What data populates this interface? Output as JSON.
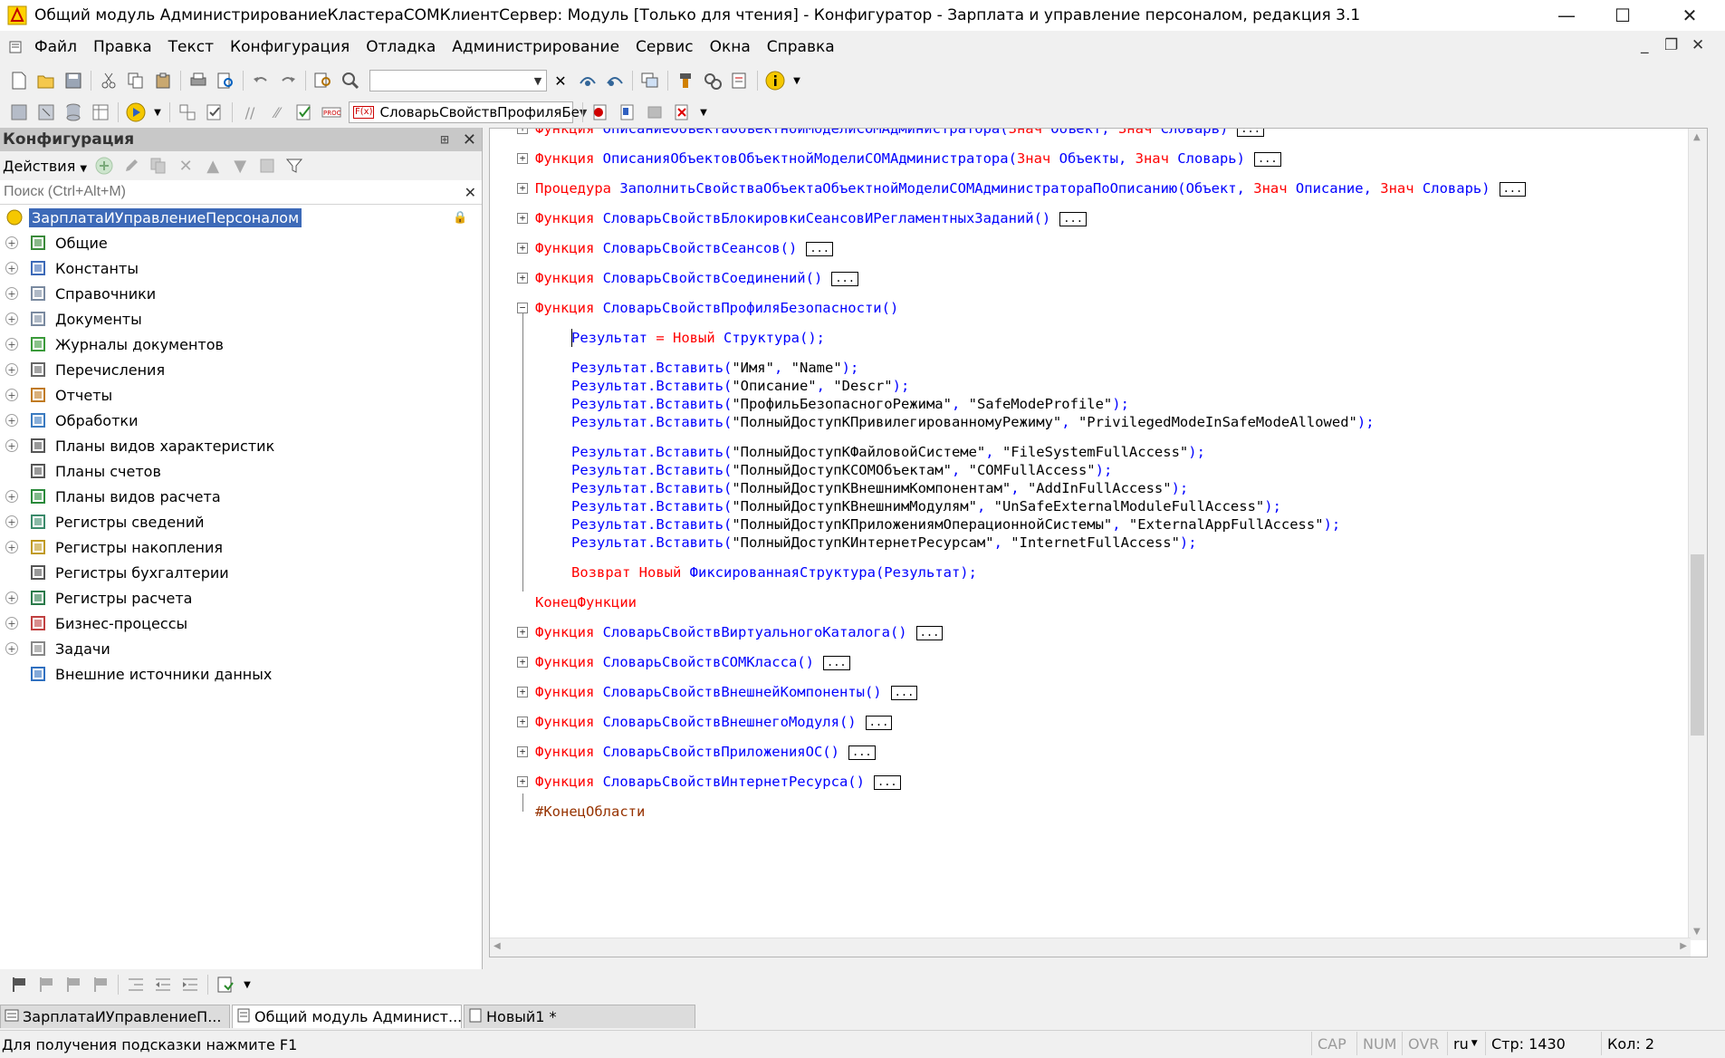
{
  "window": {
    "title": "Общий модуль АдминистрированиеКластераCOMКлиентСервер: Модуль [Только для чтения] - Конфигуратор - Зарплата и управление персоналом, редакция 3.1",
    "min": "—",
    "max": "☐",
    "close": "✕"
  },
  "menu": {
    "items": [
      "Файл",
      "Правка",
      "Текст",
      "Конфигурация",
      "Отладка",
      "Администрирование",
      "Сервис",
      "Окна",
      "Справка"
    ]
  },
  "toolbar": {
    "search_value": "",
    "proc_combo_prefix": "F(x)",
    "proc_combo_value": "СловарьСвойствПрофиляБе"
  },
  "config_panel": {
    "title": "Конфигурация",
    "actions_label": "Действия",
    "search_placeholder": "Поиск (Ctrl+Alt+M)",
    "root": "ЗарплатаИУправлениеПерсоналом",
    "items": [
      {
        "label": "Общие",
        "exp": true
      },
      {
        "label": "Константы",
        "exp": true
      },
      {
        "label": "Справочники",
        "exp": true
      },
      {
        "label": "Документы",
        "exp": true
      },
      {
        "label": "Журналы документов",
        "exp": true
      },
      {
        "label": "Перечисления",
        "exp": true
      },
      {
        "label": "Отчеты",
        "exp": true
      },
      {
        "label": "Обработки",
        "exp": true
      },
      {
        "label": "Планы видов характеристик",
        "exp": true
      },
      {
        "label": "Планы счетов",
        "exp": false
      },
      {
        "label": "Планы видов расчета",
        "exp": true
      },
      {
        "label": "Регистры сведений",
        "exp": true
      },
      {
        "label": "Регистры накопления",
        "exp": true
      },
      {
        "label": "Регистры бухгалтерии",
        "exp": false
      },
      {
        "label": "Регистры расчета",
        "exp": true
      },
      {
        "label": "Бизнес-процессы",
        "exp": true
      },
      {
        "label": "Задачи",
        "exp": true
      },
      {
        "label": "Внешние источники данных",
        "exp": false
      }
    ]
  },
  "code": {
    "collapsed_marker": "...",
    "lines": [
      {
        "kw": "Функция",
        "rest": "ОписаниеОбъектаОбъектнойМоделиCOMАдминистратора(",
        "params": [
          [
            "Знач",
            "Объект"
          ],
          [
            "Знач",
            "Словарь"
          ]
        ],
        "close": ")",
        "collapsed": true
      },
      {
        "kw": "Функция",
        "rest": "ОписанияОбъектовОбъектнойМоделиCOMАдминистратора(",
        "params": [
          [
            "Знач",
            "Объекты"
          ],
          [
            "Знач",
            "Словарь"
          ]
        ],
        "close": ")",
        "collapsed": true
      },
      {
        "kw": "Процедура",
        "rest": "ЗаполнитьСвойстваОбъектаОбъектнойМоделиCOMАдминистратораПоОписанию(Объект, ",
        "params": [
          [
            "Знач",
            "Описание"
          ],
          [
            "Знач",
            "Словарь"
          ]
        ],
        "close": ")",
        "collapsed": true
      },
      {
        "kw": "Функция",
        "rest": "СловарьСвойствБлокировкиСеансовИРегламентныхЗаданий()",
        "params": [],
        "close": "",
        "collapsed": true
      },
      {
        "kw": "Функция",
        "rest": "СловарьСвойствСеансов()",
        "params": [],
        "close": "",
        "collapsed": true
      },
      {
        "kw": "Функция",
        "rest": "СловарьСвойствСоединений()",
        "params": [],
        "close": "",
        "collapsed": true
      },
      {
        "kw": "Функция",
        "rest": "СловарьСвойствПрофиляБезопасности()",
        "params": [],
        "close": "",
        "collapsed": false
      }
    ],
    "body": {
      "line1_a": "Результат",
      "line1_b": " = ",
      "line1_c": "Новый",
      "line1_d": " Структура();",
      "inserts1": [
        [
          "\"Имя\"",
          "\"Name\""
        ],
        [
          "\"Описание\"",
          "\"Descr\""
        ],
        [
          "\"ПрофильБезопасногоРежима\"",
          "\"SafeModeProfile\""
        ],
        [
          "\"ПолныйДоступКПривилегированномуРежиму\"",
          "\"PrivilegedModeInSafeModeAllowed\""
        ]
      ],
      "inserts2": [
        [
          "\"ПолныйДоступКФайловойСистеме\"",
          "\"FileSystemFullAccess\""
        ],
        [
          "\"ПолныйДоступКCOMОбъектам\"",
          "\"COMFullAccess\""
        ],
        [
          "\"ПолныйДоступКВнешнимКомпонентам\"",
          "\"AddInFullAccess\""
        ],
        [
          "\"ПолныйДоступКВнешнимМодулям\"",
          "\"UnSafeExternalModuleFullAccess\""
        ],
        [
          "\"ПолныйДоступКПриложениямОперационнойСистемы\"",
          "\"ExternalAppFullAccess\""
        ],
        [
          "\"ПолныйДоступКИнтернетРесурсам\"",
          "\"InternetFullAccess\""
        ]
      ],
      "insert_prefix": "Результат.Вставить(",
      "ret_kw": "Возврат",
      "ret_new": "Новый",
      "ret_rest": " ФиксированнаяСтруктура(Результат);",
      "end_func": "КонецФункции"
    },
    "after": [
      "СловарьСвойствВиртуальногоКаталога()",
      "СловарьСвойствCOMКласса()",
      "СловарьСвойствВнешнейКомпоненты()",
      "СловарьСвойствВнешнегоМодуля()",
      "СловарьСвойствПриложенияОС()",
      "СловарьСвойствИнтернетРесурса()"
    ],
    "func_kw": "Функция",
    "end_region": "#КонецОбласти"
  },
  "tabs": [
    {
      "label": "ЗарплатаИУправлениеП...",
      "active": false
    },
    {
      "label": "Общий модуль Админист...",
      "active": true
    },
    {
      "label": "Новый1 *",
      "active": false
    }
  ],
  "status": {
    "hint": "Для получения подсказки нажмите F1",
    "cap": "CAP",
    "num": "NUM",
    "ovr": "OVR",
    "lang": "ru",
    "line": "Стр: 1430",
    "col": "Кол: 2"
  }
}
